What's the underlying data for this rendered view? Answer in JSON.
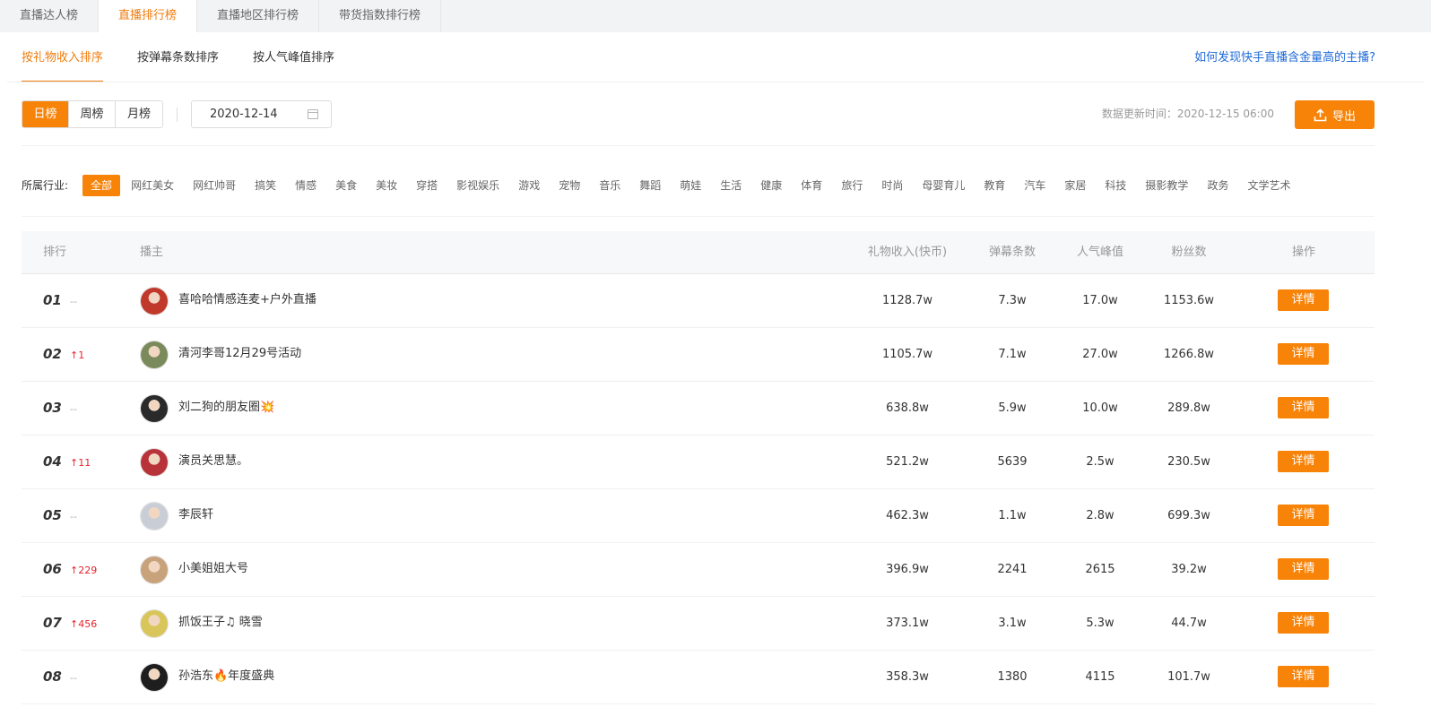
{
  "top_tabs": [
    {
      "label": "直播达人榜",
      "active": false
    },
    {
      "label": "直播排行榜",
      "active": true
    },
    {
      "label": "直播地区排行榜",
      "active": false
    },
    {
      "label": "带货指数排行榜",
      "active": false
    }
  ],
  "sub_tabs": [
    {
      "label": "按礼物收入排序",
      "active": true
    },
    {
      "label": "按弹幕条数排序",
      "active": false
    },
    {
      "label": "按人气峰值排序",
      "active": false
    }
  ],
  "help_link": "如何发现快手直播含金量高的主播?",
  "period_tabs": [
    {
      "label": "日榜",
      "active": true
    },
    {
      "label": "周榜",
      "active": false
    },
    {
      "label": "月榜",
      "active": false
    }
  ],
  "date_value": "2020-12-14",
  "update_time": "数据更新时间：2020-12-15 06:00",
  "export_label": "导出",
  "industry_label": "所属行业:",
  "industries": [
    "全部",
    "网红美女",
    "网红帅哥",
    "搞笑",
    "情感",
    "美食",
    "美妆",
    "穿搭",
    "影视娱乐",
    "游戏",
    "宠物",
    "音乐",
    "舞蹈",
    "萌娃",
    "生活",
    "健康",
    "体育",
    "旅行",
    "时尚",
    "母婴育儿",
    "教育",
    "汽车",
    "家居",
    "科技",
    "摄影教学",
    "政务",
    "文学艺术"
  ],
  "industry_active": 0,
  "table": {
    "headers": {
      "rank": "排行",
      "anchor": "播主",
      "gift": "礼物收入(快币)",
      "danmu": "弹幕条数",
      "peak": "人气峰值",
      "fans": "粉丝数",
      "op": "操作"
    },
    "detail_label": "详情",
    "rows": [
      {
        "rank": "01",
        "change": "--",
        "change_up": false,
        "name": "喜哈哈情感连麦+户外直播",
        "gift": "1128.7w",
        "danmu": "7.3w",
        "peak": "17.0w",
        "fans": "1153.6w",
        "avatar_color": "#c0392b"
      },
      {
        "rank": "02",
        "change": "1",
        "change_up": true,
        "name": "清河李哥12月29号活动",
        "gift": "1105.7w",
        "danmu": "7.1w",
        "peak": "27.0w",
        "fans": "1266.8w",
        "avatar_color": "#7a8a5a"
      },
      {
        "rank": "03",
        "change": "--",
        "change_up": false,
        "name": "刘二狗的朋友圈💥",
        "gift": "638.8w",
        "danmu": "5.9w",
        "peak": "10.0w",
        "fans": "289.8w",
        "avatar_color": "#2a2a2a"
      },
      {
        "rank": "04",
        "change": "11",
        "change_up": true,
        "name": "演员关思慧。",
        "gift": "521.2w",
        "danmu": "5639",
        "peak": "2.5w",
        "fans": "230.5w",
        "avatar_color": "#b8323a"
      },
      {
        "rank": "05",
        "change": "--",
        "change_up": false,
        "name": "李辰轩",
        "gift": "462.3w",
        "danmu": "1.1w",
        "peak": "2.8w",
        "fans": "699.3w",
        "avatar_color": "#c9ced6"
      },
      {
        "rank": "06",
        "change": "229",
        "change_up": true,
        "name": "小美姐姐大号",
        "gift": "396.9w",
        "danmu": "2241",
        "peak": "2615",
        "fans": "39.2w",
        "avatar_color": "#c8a27a"
      },
      {
        "rank": "07",
        "change": "456",
        "change_up": true,
        "name": "抓饭王子♫ 晓雪",
        "gift": "373.1w",
        "danmu": "3.1w",
        "peak": "5.3w",
        "fans": "44.7w",
        "avatar_color": "#d8c65a"
      },
      {
        "rank": "08",
        "change": "--",
        "change_up": false,
        "name": "孙浩东🔥年度盛典",
        "gift": "358.3w",
        "danmu": "1380",
        "peak": "4115",
        "fans": "101.7w",
        "avatar_color": "#1e1e1e"
      }
    ]
  },
  "colors": {
    "accent": "#f78308",
    "accent_text": "#f07c0f",
    "link": "#1f6ad8",
    "up": "#e8222d"
  }
}
